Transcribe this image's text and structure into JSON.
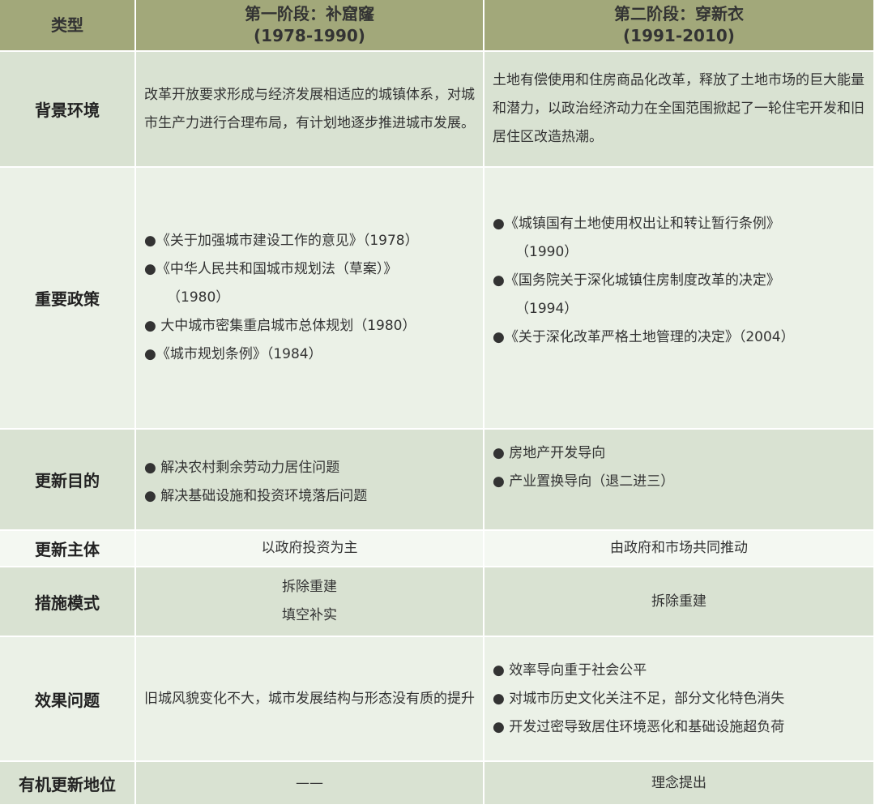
{
  "header": {
    "type_label": "类型",
    "stage1_title": "第一阶段：补窟窿",
    "stage1_years": "(1978-1990)",
    "stage2_title": "第二阶段：穿新衣",
    "stage2_years": "(1991-2010)"
  },
  "rows": {
    "background": {
      "label": "背景环境",
      "stage1": "改革开放要求形成与经济发展相适应的城镇体系，对城市生产力进行合理布局，有计划地逐步推进城市发展。",
      "stage2": "土地有偿使用和住房商品化改革，释放了土地市场的巨大能量和潜力，以政治经济动力在全国范围掀起了一轮住宅开发和旧居住区改造热潮。"
    },
    "policy": {
      "label": "重要政策",
      "stage1": [
        "●《关于加强城市建设工作的意见》（1978）",
        "●《中华人民共和国城市规划法（草案）》",
        "（1980）",
        "● 大中城市密集重启城市总体规划（1980）",
        "●《城市规划条例》（1984）"
      ],
      "stage2": [
        "●《城镇国有土地使用权出让和转让暂行条例》",
        "（1990）",
        "●《国务院关于深化城镇住房制度改革的决定》",
        "（1994）",
        "●《关于深化改革严格土地管理的决定》（2004）"
      ]
    },
    "goal": {
      "label": "更新目的",
      "stage1": [
        "● 解决农村剩余劳动力居住问题",
        "● 解决基础设施和投资环境落后问题"
      ],
      "stage2": [
        "● 房地产开发导向",
        "● 产业置换导向（退二进三）"
      ]
    },
    "subject": {
      "label": "更新主体",
      "stage1": "以政府投资为主",
      "stage2": "由政府和市场共同推动"
    },
    "mode": {
      "label": "措施模式",
      "stage1": [
        "拆除重建",
        "填空补实"
      ],
      "stage2": "拆除重建"
    },
    "effect": {
      "label": "效果问题",
      "stage1": "旧城风貌变化不大，城市发展结构与形态没有质的提升",
      "stage2": [
        "● 效率导向重于社会公平",
        "● 对城市历史文化关注不足，部分文化特色消失",
        "● 开发过密导致居住环境恶化和基础设施超负荷"
      ]
    },
    "status": {
      "label": "有机更新地位",
      "stage1": "——",
      "stage2": "理念提出"
    }
  },
  "colors": {
    "header_bg": "#a2a87a",
    "row_shade": "#d9e2d2",
    "row_light": "#ebf1e7"
  }
}
